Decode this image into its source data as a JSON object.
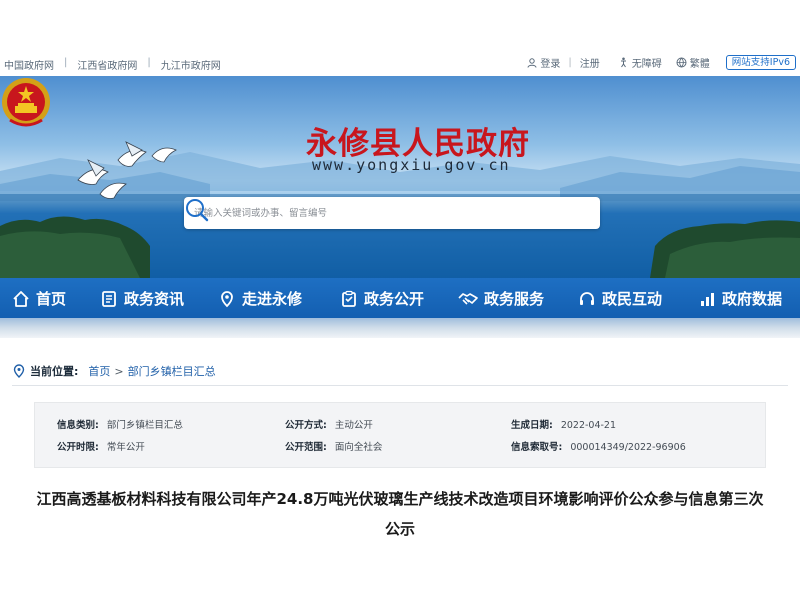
{
  "topbar": {
    "links": [
      "中国政府网",
      "江西省政府网",
      "九江市政府网"
    ],
    "login": "登录",
    "register": "注册",
    "accessibility": "无障碍",
    "traditional": "繁體",
    "ipv6": "网站支持IPv6"
  },
  "header": {
    "title": "永修县人民政府",
    "url": "www.yongxiu.gov.cn"
  },
  "search": {
    "placeholder": "请输入关键词或办事、留言编号"
  },
  "nav": {
    "items": [
      "首页",
      "政务资讯",
      "走进永修",
      "政务公开",
      "政务服务",
      "政民互动",
      "政府数据"
    ]
  },
  "breadcrumb": {
    "label": "当前位置:",
    "home": "首页",
    "separator": ">",
    "current": "部门乡镇栏目汇总"
  },
  "info": {
    "category_label": "信息类别:",
    "category_value": "部门乡镇栏目汇总",
    "method_label": "公开方式:",
    "method_value": "主动公开",
    "date_label": "生成日期:",
    "date_value": "2022-04-21",
    "period_label": "公开时限:",
    "period_value": "常年公开",
    "scope_label": "公开范围:",
    "scope_value": "面向全社会",
    "index_label": "信息索取号:",
    "index_value": "000014349/2022-96906"
  },
  "article": {
    "title": "江西高透基板材料科技有限公司年产24.8万吨光伏玻璃生产线技术改造项目环境影响评价公众参与信息第三次公示"
  },
  "colors": {
    "nav_blue": "#1a67bb",
    "title_red": "#c8161d",
    "link_blue": "#1f5fa8"
  }
}
